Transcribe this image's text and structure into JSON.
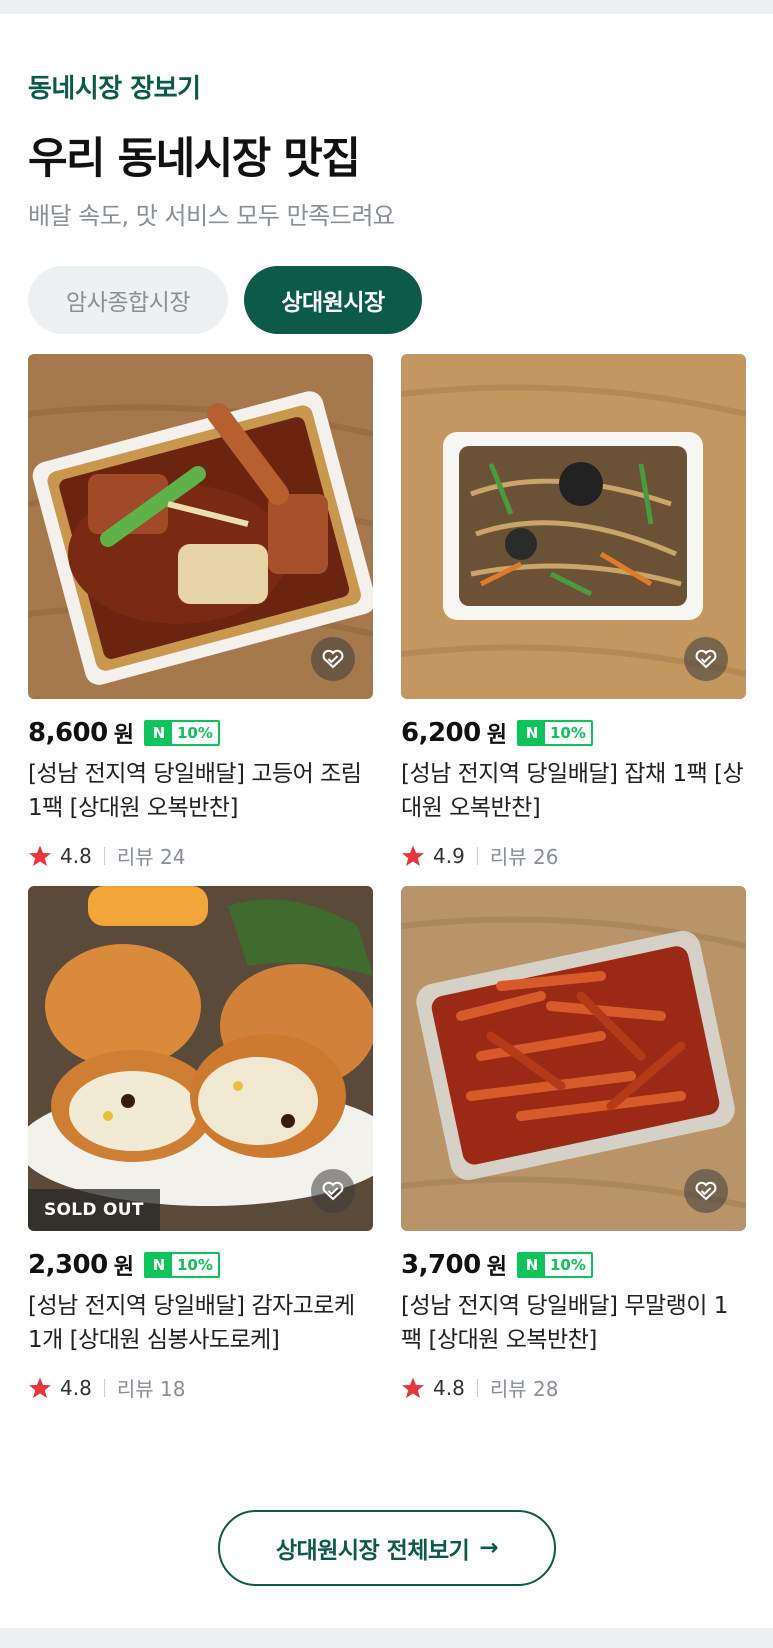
{
  "header": {
    "eyebrow": "동네시장 장보기",
    "title": "우리 동네시장 맛집",
    "subtitle": "배달 속도, 맛 서비스 모두 만족드려요"
  },
  "chips": [
    {
      "label": "암사종합시장",
      "selected": false
    },
    {
      "label": "상대원시장",
      "selected": true
    }
  ],
  "badge": {
    "n": "N",
    "discount": "10%"
  },
  "currency": "원",
  "review_prefix": "리뷰",
  "products": [
    {
      "price": "8,600",
      "name": "[성남 전지역 당일배달] 고등어 조림 1팩 [상대원 오복반찬]",
      "rating": "4.8",
      "reviews": "24",
      "sold_out": false
    },
    {
      "price": "6,200",
      "name": "[성남 전지역 당일배달] 잡채 1팩 [상대원 오복반찬]",
      "rating": "4.9",
      "reviews": "26",
      "sold_out": false
    },
    {
      "price": "2,300",
      "name": "[성남 전지역 당일배달] 감자고로케 1개 [상대원 심봉사도로케]",
      "rating": "4.8",
      "reviews": "18",
      "sold_out": true,
      "sold_out_label": "SOLD OUT"
    },
    {
      "price": "3,700",
      "name": "[성남 전지역 당일배달] 무말랭이 1팩 [상대원 오복반찬]",
      "rating": "4.8",
      "reviews": "28",
      "sold_out": false
    }
  ],
  "more_button": {
    "label": "상대원시장 전체보기",
    "arrow": "→"
  },
  "colors": {
    "brand": "#0c5a4a",
    "npay": "#0fc35b",
    "star": "#e8363d"
  }
}
